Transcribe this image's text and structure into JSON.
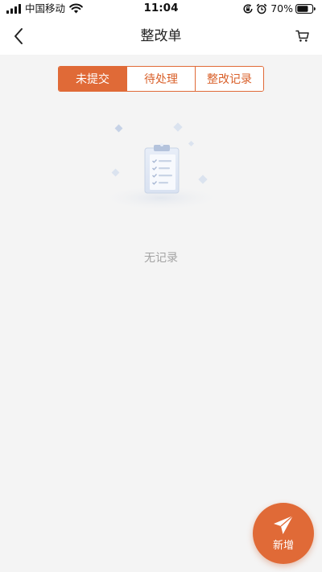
{
  "status_bar": {
    "carrier": "中国移动",
    "time": "11:04",
    "battery": "70%",
    "icons": [
      "signal-icon",
      "wifi-icon",
      "rotation-lock-icon",
      "alarm-icon",
      "battery-icon"
    ]
  },
  "nav": {
    "title": "整改单",
    "back_icon": "chevron-left-icon",
    "cart_icon": "cart-icon"
  },
  "tabs": [
    {
      "label": "未提交",
      "active": true
    },
    {
      "label": "待处理",
      "active": false
    },
    {
      "label": "整改记录",
      "active": false
    }
  ],
  "empty_state": {
    "icon": "clipboard-checklist-icon",
    "text": "无记录"
  },
  "fab": {
    "label": "新增",
    "icon": "paper-plane-icon"
  },
  "colors": {
    "accent": "#e06a37",
    "background": "#f4f4f4",
    "empty_text": "#a3a3a3"
  }
}
